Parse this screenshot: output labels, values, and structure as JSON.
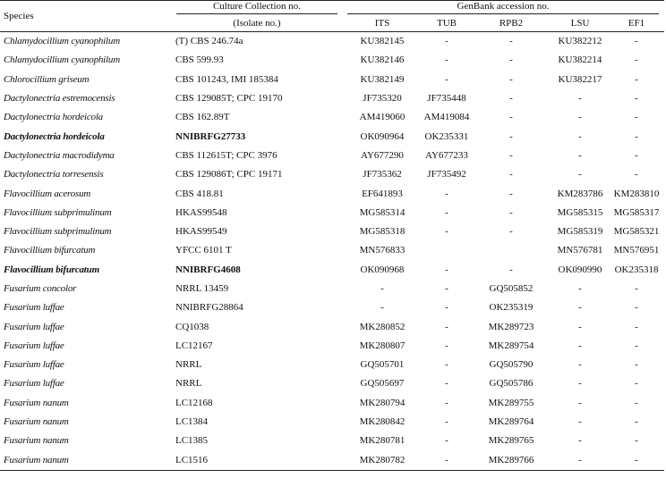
{
  "headers": {
    "species": "Species",
    "culture_collection": "Culture Collection no.",
    "isolate": "(Isolate no.)",
    "genbank": "GenBank accession no.",
    "its": "ITS",
    "tub": "TUB",
    "rpb2": "RPB2",
    "lsu": "LSU",
    "ef1": "EF1"
  },
  "rows": [
    {
      "species": "Chlamydocillium cyanophilum",
      "cc": "(T) CBS 246.74a",
      "its": "KU382145",
      "tub": "-",
      "rpb2": "-",
      "lsu": "KU382212",
      "ef1": "-",
      "bold": false
    },
    {
      "species": "Chlamydocillium cyanophilum",
      "cc": "CBS 599.93",
      "its": "KU382146",
      "tub": "-",
      "rpb2": "-",
      "lsu": "KU382214",
      "ef1": "-",
      "bold": false
    },
    {
      "species": "Chlorocillium griseum",
      "cc": "CBS 101243, IMI 185384",
      "its": "KU382149",
      "tub": "-",
      "rpb2": "-",
      "lsu": "KU382217",
      "ef1": "-",
      "bold": false
    },
    {
      "species": "Dactylonectria estremocensis",
      "cc": "CBS 129085T; CPC 19170",
      "its": "JF735320",
      "tub": "JF735448",
      "rpb2": "-",
      "lsu": "-",
      "ef1": "-",
      "bold": false
    },
    {
      "species": "Dactylonectria hordeicola",
      "cc": "CBS 162.89T",
      "its": "AM419060",
      "tub": "AM419084",
      "rpb2": "-",
      "lsu": "-",
      "ef1": "-",
      "bold": false
    },
    {
      "species": "Dactylonectria hordeicola",
      "cc": "NNIBRFG27733",
      "its": "OK090964",
      "tub": "OK235331",
      "rpb2": "-",
      "lsu": "-",
      "ef1": "-",
      "bold": true
    },
    {
      "species": "Dactylonectria macrodidyma",
      "cc": "CBS 112615T; CPC 3976",
      "its": "AY677290",
      "tub": "AY677233",
      "rpb2": "-",
      "lsu": "-",
      "ef1": "-",
      "bold": false
    },
    {
      "species": "Dactylonectria torresensis",
      "cc": "CBS 129086T; CPC 19171",
      "its": "JF735362",
      "tub": "JF735492",
      "rpb2": "-",
      "lsu": "-",
      "ef1": "-",
      "bold": false
    },
    {
      "species": "Flavocillium acerosum",
      "cc": "CBS 418.81",
      "its": "EF641893",
      "tub": "-",
      "rpb2": "-",
      "lsu": "KM283786",
      "ef1": "KM283810",
      "bold": false
    },
    {
      "species": "Flavocillium subprimulinum",
      "cc": "HKAS99548",
      "its": "MG585314",
      "tub": "-",
      "rpb2": "-",
      "lsu": "MG585315",
      "ef1": "MG585317",
      "bold": false
    },
    {
      "species": "Flavocillium subprimulinum",
      "cc": "HKAS99549",
      "its": "MG585318",
      "tub": "-",
      "rpb2": "-",
      "lsu": "MG585319",
      "ef1": "MG585321",
      "bold": false
    },
    {
      "species": "Flavocillium bifurcatum",
      "cc": "YFCC 6101 T",
      "its": "MN576833",
      "tub": "",
      "rpb2": "",
      "lsu": "MN576781",
      "ef1": "MN576951",
      "bold": false
    },
    {
      "species": "Flavocillium bifurcatum",
      "cc": "NNIBRFG4608",
      "its": "OK090968",
      "tub": "-",
      "rpb2": "-",
      "lsu": "OK090990",
      "ef1": "OK235318",
      "bold": true
    },
    {
      "species": "Fusarium concolor",
      "cc": "NRRL 13459",
      "its": "-",
      "tub": "-",
      "rpb2": "GQ505852",
      "lsu": "-",
      "ef1": "-",
      "bold": false
    },
    {
      "species": "Fusarium luffae",
      "cc": "NNIBRFG28864",
      "its": "-",
      "tub": "-",
      "rpb2": "OK235319",
      "lsu": "-",
      "ef1": "-",
      "bold": false
    },
    {
      "species": "Fusarium luffae",
      "cc": "CQ1038",
      "its": "MK280852",
      "tub": "-",
      "rpb2": "MK289723",
      "lsu": "-",
      "ef1": "-",
      "bold": false
    },
    {
      "species": "Fusarium luffae",
      "cc": "LC12167",
      "its": "MK280807",
      "tub": "-",
      "rpb2": "MK289754",
      "lsu": "-",
      "ef1": "-",
      "bold": false
    },
    {
      "species": "Fusarium luffae",
      "cc": "NRRL",
      "its": "GQ505701",
      "tub": "-",
      "rpb2": "GQ505790",
      "lsu": "-",
      "ef1": "-",
      "bold": false
    },
    {
      "species": "Fusarium luffae",
      "cc": "NRRL",
      "its": "GQ505697",
      "tub": "-",
      "rpb2": "GQ505786",
      "lsu": "-",
      "ef1": "-",
      "bold": false
    },
    {
      "species": "Fusarium nanum",
      "cc": "LC12168",
      "its": "MK280794",
      "tub": "-",
      "rpb2": "MK289755",
      "lsu": "-",
      "ef1": "-",
      "bold": false
    },
    {
      "species": "Fusarium nanum",
      "cc": "LC1384",
      "its": "MK280842",
      "tub": "-",
      "rpb2": "MK289764",
      "lsu": "-",
      "ef1": "-",
      "bold": false
    },
    {
      "species": "Fusarium nanum",
      "cc": "LC1385",
      "its": "MK280781",
      "tub": "-",
      "rpb2": "MK289765",
      "lsu": "-",
      "ef1": "-",
      "bold": false
    },
    {
      "species": "Fusarium nanum",
      "cc": "LC1516",
      "its": "MK280782",
      "tub": "-",
      "rpb2": "MK289766",
      "lsu": "-",
      "ef1": "-",
      "bold": false
    }
  ]
}
